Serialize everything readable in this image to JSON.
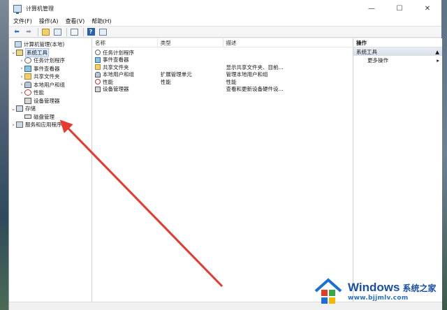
{
  "window": {
    "title": "计算机管理",
    "controls": {
      "minimize": "—",
      "maximize": "☐",
      "close": "✕"
    }
  },
  "menu": [
    "文件(F)",
    "操作(A)",
    "查看(V)",
    "帮助(H)"
  ],
  "tree": {
    "root": "计算机管理(本地)",
    "system_tools": "系统工具",
    "task_scheduler": "任务计划程序",
    "event_viewer": "事件查看器",
    "shared_folders": "共享文件夹",
    "local_users": "本地用户和组",
    "performance": "性能",
    "device_manager": "设备管理器",
    "storage": "存储",
    "disk_management": "磁盘管理",
    "services": "服务和应用程序"
  },
  "list": {
    "headers": {
      "name": "名称",
      "type": "类型",
      "desc": "描述"
    },
    "rows": [
      {
        "name": "任务计划程序",
        "type": "",
        "desc": ""
      },
      {
        "name": "事件查看器",
        "type": "",
        "desc": ""
      },
      {
        "name": "共享文件夹",
        "type": "",
        "desc": "显示共享文件夹、目前..."
      },
      {
        "name": "本地用户和组",
        "type": "扩展管理单元",
        "desc": "管理本地用户和组"
      },
      {
        "name": "性能",
        "type": "性能",
        "desc": "性能"
      },
      {
        "name": "设备管理器",
        "type": "",
        "desc": "查看和更新设备硬件设..."
      }
    ]
  },
  "actions": {
    "title": "操作",
    "section": "系统工具",
    "more": "更多操作"
  },
  "watermark": {
    "brand": "Windows",
    "cn": "系统之家",
    "url": "www.bjjmlv.com"
  },
  "colors": {
    "arrow": "#e8392e",
    "selection": "#d9e8fb",
    "brand_blue": "#1a4fa8"
  }
}
